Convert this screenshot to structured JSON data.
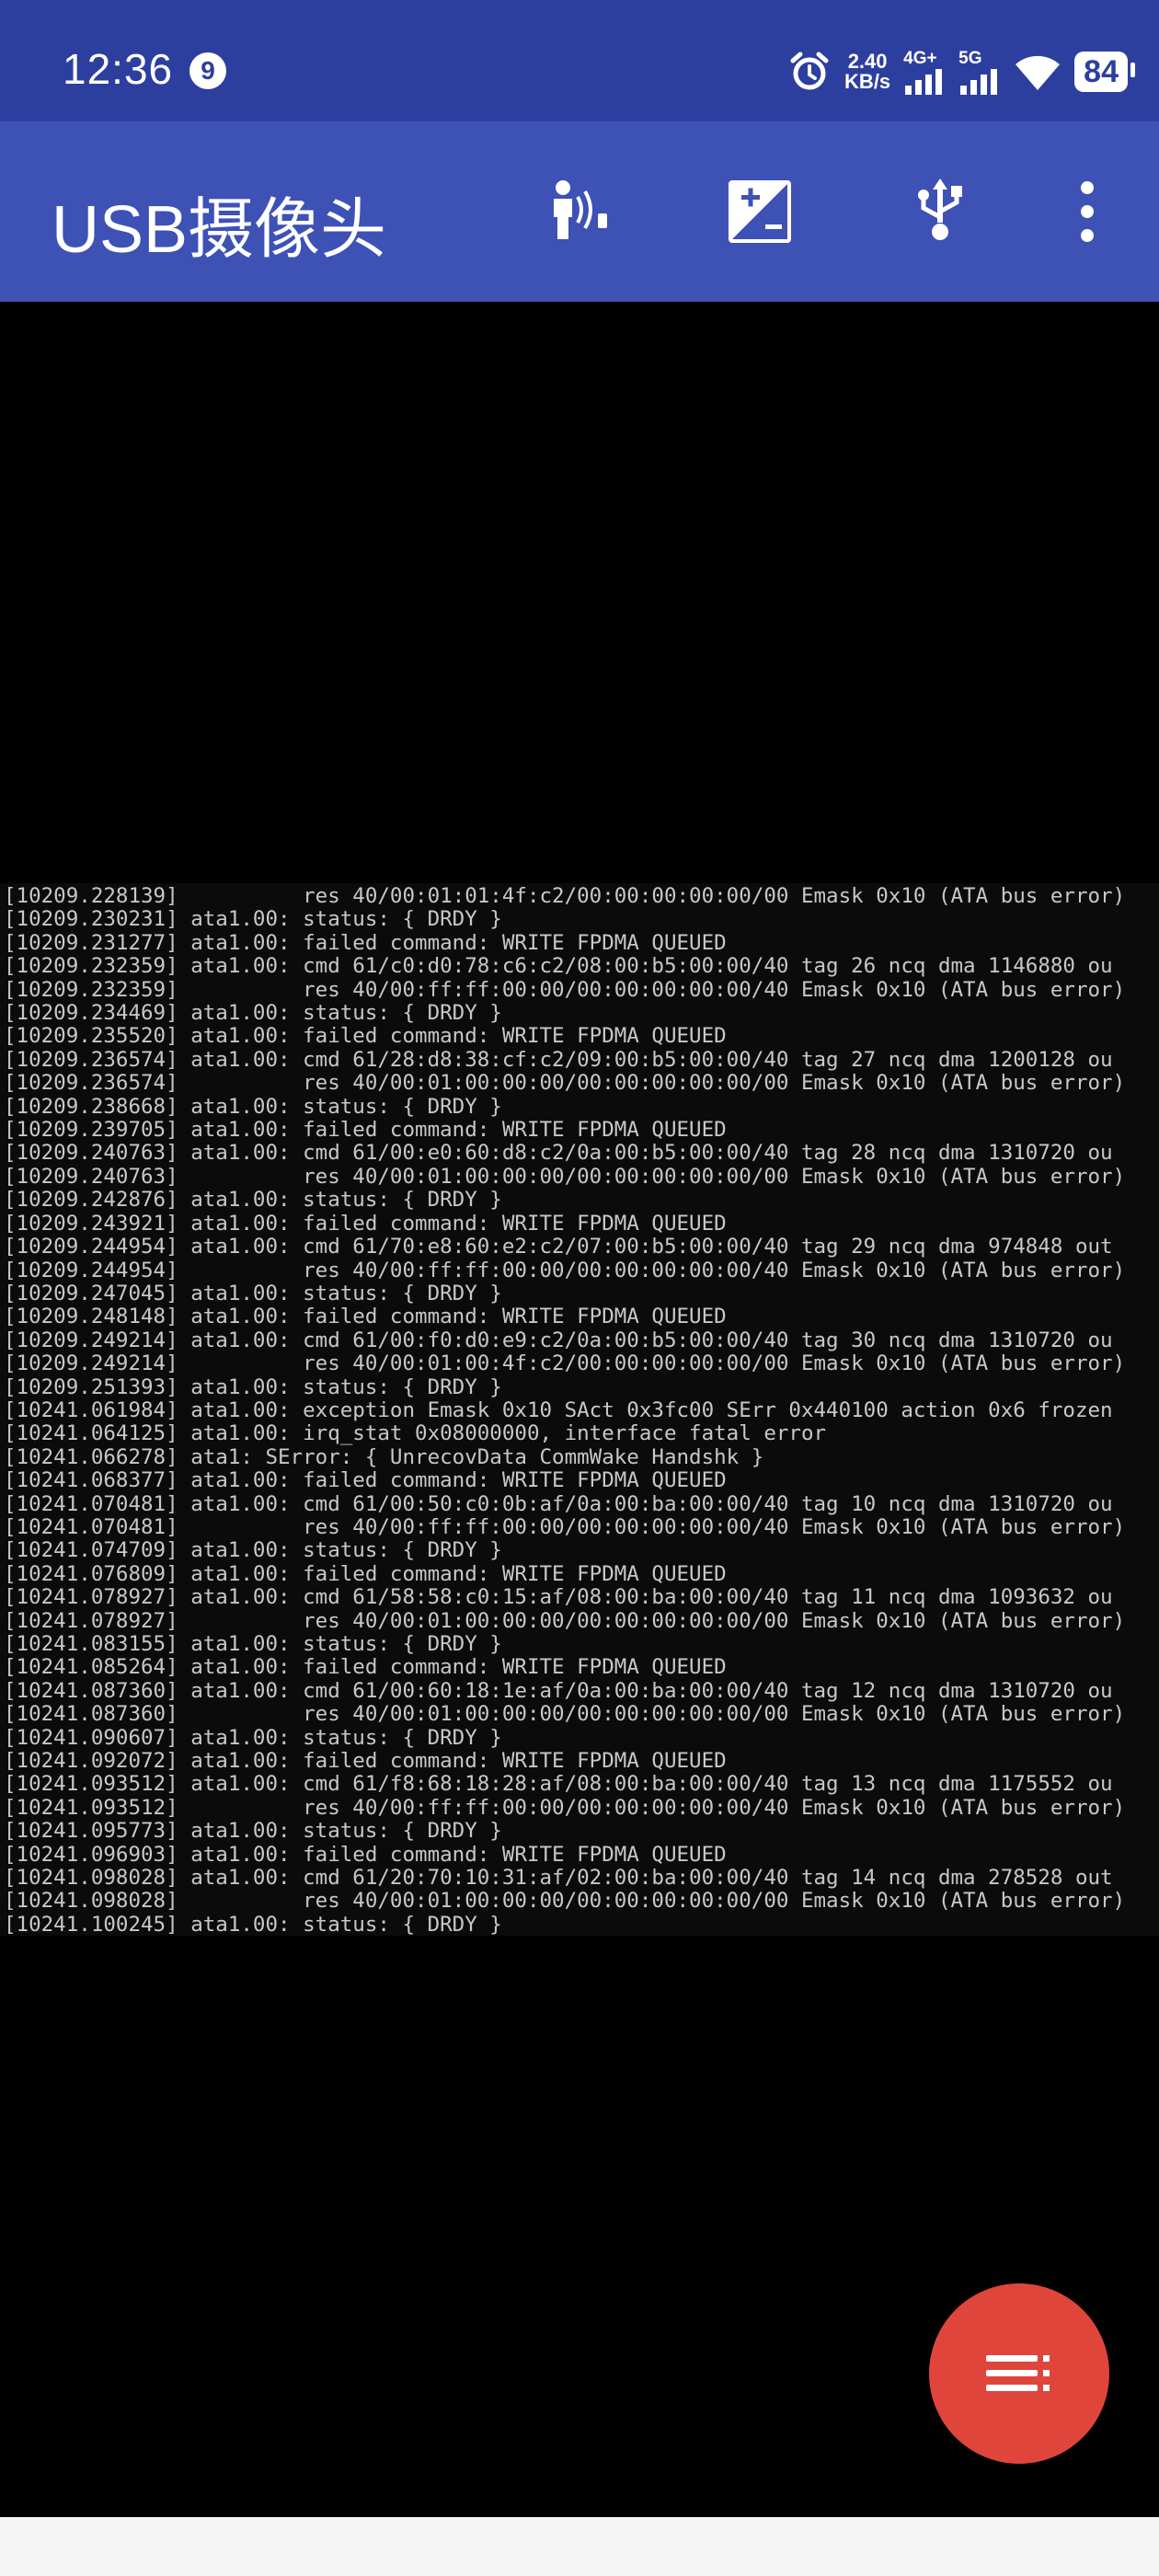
{
  "status_bar": {
    "time": "12:36",
    "notification_count": "9",
    "speed_value": "2.40",
    "speed_unit": "KB/s",
    "net1_label": "4G+",
    "net2_label": "5G",
    "battery": "84"
  },
  "app_bar": {
    "title": "USB摄像头",
    "icons": [
      "voice-control-icon",
      "exposure-icon",
      "usb-icon",
      "more-options-icon"
    ]
  },
  "log_lines": [
    "[10209.228139]          res 40/00:01:01:4f:c2/00:00:00:00:00/00 Emask 0x10 (ATA bus error)",
    "[10209.230231] ata1.00: status: { DRDY }",
    "[10209.231277] ata1.00: failed command: WRITE FPDMA QUEUED",
    "[10209.232359] ata1.00: cmd 61/c0:d0:78:c6:c2/08:00:b5:00:00/40 tag 26 ncq dma 1146880 ou",
    "[10209.232359]          res 40/00:ff:ff:00:00/00:00:00:00:00/40 Emask 0x10 (ATA bus error)",
    "[10209.234469] ata1.00: status: { DRDY }",
    "[10209.235520] ata1.00: failed command: WRITE FPDMA QUEUED",
    "[10209.236574] ata1.00: cmd 61/28:d8:38:cf:c2/09:00:b5:00:00/40 tag 27 ncq dma 1200128 ou",
    "[10209.236574]          res 40/00:01:00:00:00/00:00:00:00:00/00 Emask 0x10 (ATA bus error)",
    "[10209.238668] ata1.00: status: { DRDY }",
    "[10209.239705] ata1.00: failed command: WRITE FPDMA QUEUED",
    "[10209.240763] ata1.00: cmd 61/00:e0:60:d8:c2/0a:00:b5:00:00/40 tag 28 ncq dma 1310720 ou",
    "[10209.240763]          res 40/00:01:00:00:00/00:00:00:00:00/00 Emask 0x10 (ATA bus error)",
    "[10209.242876] ata1.00: status: { DRDY }",
    "[10209.243921] ata1.00: failed command: WRITE FPDMA QUEUED",
    "[10209.244954] ata1.00: cmd 61/70:e8:60:e2:c2/07:00:b5:00:00/40 tag 29 ncq dma 974848 out",
    "[10209.244954]          res 40/00:ff:ff:00:00/00:00:00:00:00/40 Emask 0x10 (ATA bus error)",
    "[10209.247045] ata1.00: status: { DRDY }",
    "[10209.248148] ata1.00: failed command: WRITE FPDMA QUEUED",
    "[10209.249214] ata1.00: cmd 61/00:f0:d0:e9:c2/0a:00:b5:00:00/40 tag 30 ncq dma 1310720 ou",
    "[10209.249214]          res 40/00:01:00:4f:c2/00:00:00:00:00/00 Emask 0x10 (ATA bus error)",
    "[10209.251393] ata1.00: status: { DRDY }",
    "[10241.061984] ata1.00: exception Emask 0x10 SAct 0x3fc00 SErr 0x440100 action 0x6 frozen",
    "[10241.064125] ata1.00: irq_stat 0x08000000, interface fatal error",
    "[10241.066278] ata1: SError: { UnrecovData CommWake Handshk }",
    "[10241.068377] ata1.00: failed command: WRITE FPDMA QUEUED",
    "[10241.070481] ata1.00: cmd 61/00:50:c0:0b:af/0a:00:ba:00:00/40 tag 10 ncq dma 1310720 ou",
    "[10241.070481]          res 40/00:ff:ff:00:00/00:00:00:00:00/40 Emask 0x10 (ATA bus error)",
    "[10241.074709] ata1.00: status: { DRDY }",
    "[10241.076809] ata1.00: failed command: WRITE FPDMA QUEUED",
    "[10241.078927] ata1.00: cmd 61/58:58:c0:15:af/08:00:ba:00:00/40 tag 11 ncq dma 1093632 ou",
    "[10241.078927]          res 40/00:01:00:00:00/00:00:00:00:00/00 Emask 0x10 (ATA bus error)",
    "[10241.083155] ata1.00: status: { DRDY }",
    "[10241.085264] ata1.00: failed command: WRITE FPDMA QUEUED",
    "[10241.087360] ata1.00: cmd 61/00:60:18:1e:af/0a:00:ba:00:00/40 tag 12 ncq dma 1310720 ou",
    "[10241.087360]          res 40/00:01:00:00:00/00:00:00:00:00/00 Emask 0x10 (ATA bus error)",
    "[10241.090607] ata1.00: status: { DRDY }",
    "[10241.092072] ata1.00: failed command: WRITE FPDMA QUEUED",
    "[10241.093512] ata1.00: cmd 61/f8:68:18:28:af/08:00:ba:00:00/40 tag 13 ncq dma 1175552 ou",
    "[10241.093512]          res 40/00:ff:ff:00:00/00:00:00:00:00/40 Emask 0x10 (ATA bus error)",
    "[10241.095773] ata1.00: status: { DRDY }",
    "[10241.096903] ata1.00: failed command: WRITE FPDMA QUEUED",
    "[10241.098028] ata1.00: cmd 61/20:70:10:31:af/02:00:ba:00:00/40 tag 14 ncq dma 278528 out",
    "[10241.098028]          res 40/00:01:00:00:00/00:00:00:00:00/00 Emask 0x10 (ATA bus error)",
    "[10241.100245] ata1.00: status: { DRDY }"
  ],
  "fab": {
    "icon": "menu-list-icon"
  },
  "colors": {
    "status_bar_bg": "#2d3f9e",
    "app_bar_bg": "#3e51b5",
    "fab_bg": "#e0453b",
    "log_text": "#c8c8c8"
  }
}
